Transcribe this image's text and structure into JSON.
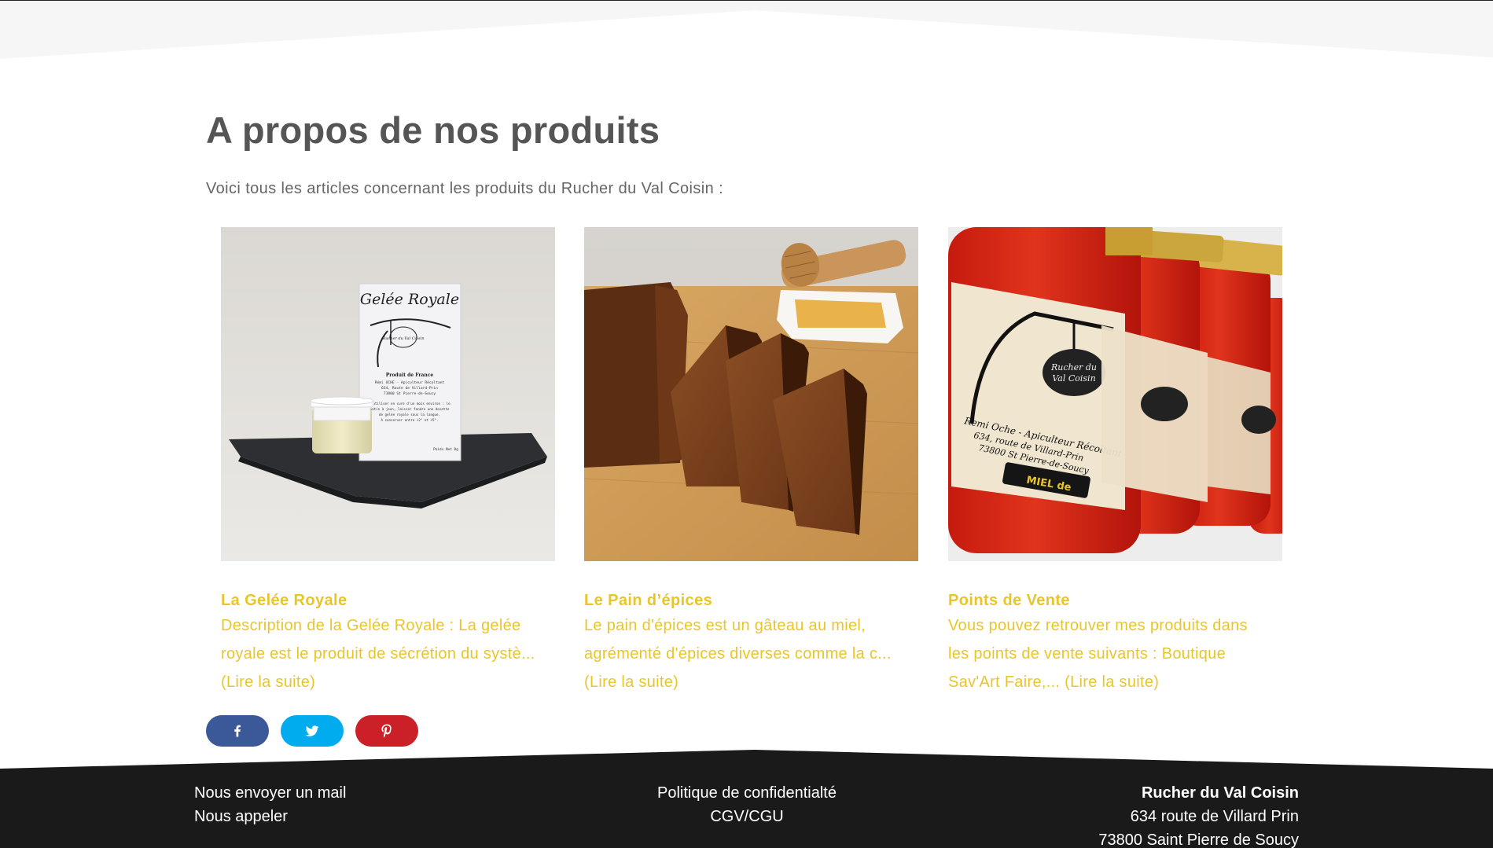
{
  "section": {
    "title": "A propos de nos produits",
    "intro": "Voici tous les articles concernant les produits du Rucher du Val Coisin :"
  },
  "cards": [
    {
      "title": "La Gelée Royale",
      "excerpt_lines": [
        "Description de la Gelée Royale : La gelée",
        "royale est le produit de sécrétion du systè..."
      ],
      "read_more": "(Lire la suite)",
      "image_text": {
        "box_title": "Gelée Royale",
        "box_subtitle": "Produit de France",
        "box_address": [
          "Rémi OCHE - Apiculteur Récoltant",
          "634, Route de Villard-Prin",
          "73800 St Pierre-de-Soucy"
        ],
        "box_usage": [
          "A utiliser en cure d'un mois environ : le",
          "matin à jeun, laisser fondre une dosette",
          "de gelée royale sous la langue.",
          "A conserver entre +2° et +5°."
        ],
        "box_weight": "Poids Net 8g",
        "box_logo": "Rucher du Val Coisin"
      }
    },
    {
      "title": "Le Pain d’épices",
      "excerpt_lines": [
        "Le pain d'épices est un gâteau au miel,",
        "agrémenté d'épices diverses comme la c..."
      ],
      "read_more": "(Lire la suite)"
    },
    {
      "title": "Points de Vente",
      "excerpt_lines": [
        "Vous pouvez retrouver mes produits dans",
        "les points de vente suivants : Boutique"
      ],
      "excerpt_last": "Sav'Art Faire,... ",
      "read_more": "(Lire la suite)",
      "image_text": {
        "logo": [
          "Rucher du",
          "Val Coisin"
        ],
        "address": [
          "Remi Oche - Apiculteur Récoltant",
          "634, route de Villard-Prin",
          "73800 St Pierre-de-Soucy"
        ],
        "tag": "MIEL de"
      }
    }
  ],
  "share": {
    "facebook_color": "#3b5998",
    "twitter_color": "#00aced",
    "pinterest_color": "#cb2027"
  },
  "footer": {
    "left": [
      "Nous envoyer un mail",
      "Nous appeler"
    ],
    "middle": [
      "Politique de confidentialté",
      "CGV/CGU"
    ],
    "company": "Rucher du Val Coisin",
    "address_lines": [
      "634 route de Villard Prin",
      "73800 Saint Pierre de Soucy"
    ]
  },
  "colors": {
    "accent": "#e8c629",
    "heading": "#555555",
    "footer_bg": "#1a1a1a"
  }
}
